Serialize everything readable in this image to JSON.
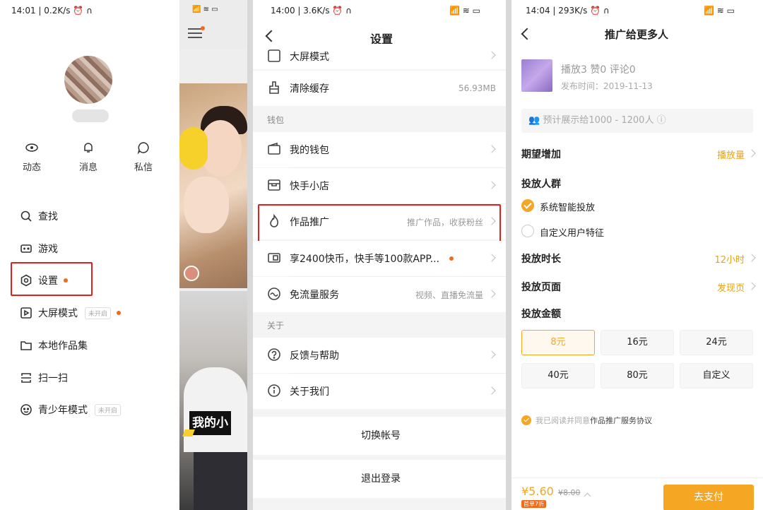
{
  "panel1": {
    "time": "14:01",
    "speed": "0.2K/s",
    "quick": [
      {
        "label": "动态",
        "icon": "eye-icon"
      },
      {
        "label": "消息",
        "icon": "bell-icon"
      },
      {
        "label": "私信",
        "icon": "chat-icon"
      }
    ],
    "menu": [
      {
        "label": "查找",
        "icon": "search-icon"
      },
      {
        "label": "游戏",
        "icon": "gamepad-icon"
      },
      {
        "label": "设置",
        "icon": "settings-icon"
      },
      {
        "label": "大屏模式",
        "icon": "play-screen-icon",
        "tag": "未开启"
      },
      {
        "label": "本地作品集",
        "icon": "folder-icon"
      },
      {
        "label": "扫一扫",
        "icon": "scan-icon"
      },
      {
        "label": "青少年模式",
        "icon": "teen-mode-icon",
        "tag": "未开启"
      }
    ]
  },
  "panel2": {
    "caption": "我的小"
  },
  "panel3": {
    "time": "14:00",
    "speed": "3.6K/s",
    "title": "设置",
    "partial_row": "大屏模式",
    "cache": {
      "label": "清除缓存",
      "value": "56.93MB"
    },
    "section_wallet": "钱包",
    "wallet": {
      "label": "我的钱包"
    },
    "shop": {
      "label": "快手小店"
    },
    "promote": {
      "label": "作品推广",
      "value": "推广作品，收获粉丝"
    },
    "coins": {
      "label": "享2400快币，快手等100款APP..."
    },
    "freeflow": {
      "label": "免流量服务",
      "value": "视频、直播免流量"
    },
    "section_about": "关于",
    "feedback": {
      "label": "反馈与帮助"
    },
    "about": {
      "label": "关于我们"
    },
    "switch_account": "切换帐号",
    "logout": "退出登录"
  },
  "panel4": {
    "time": "14:04",
    "speed": "293K/s",
    "title": "推广给更多人",
    "stats": "播放3  赞0  评论0",
    "pubdate": "发布时间：2019-11-13",
    "estimate": "预计展示给1000 - 1200人",
    "expect_label": "期望增加",
    "expect_value": "播放量",
    "audience_label": "投放人群",
    "audience_option1": "系统智能投放",
    "audience_option2": "自定义用户特征",
    "duration_label": "投放时长",
    "duration_value": "12小时",
    "page_label": "投放页面",
    "page_value": "发现页",
    "amount_label": "投放金额",
    "amounts": [
      "8元",
      "16元",
      "24元",
      "40元",
      "80元",
      "自定义"
    ],
    "agree_prefix": "我已阅读并同意",
    "agree_link": "作品推广服务协议",
    "price": "¥5.60",
    "old_price": "¥8.00",
    "discount": "首单7折",
    "pay": "去支付"
  },
  "colors": {
    "accent": "#f5a623",
    "highlight": "#e02020",
    "dot": "#f26a1b"
  }
}
